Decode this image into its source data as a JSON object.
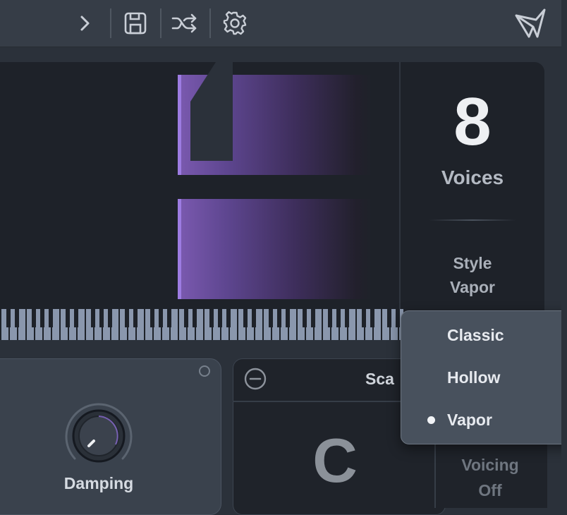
{
  "toolbar": {
    "icons": [
      "chevron-right-icon",
      "save-icon",
      "shuffle-icon",
      "gear-icon",
      "brand-logo"
    ]
  },
  "display": {
    "voices_count": "8",
    "voices_label": "Voices",
    "style_label": "Style",
    "style_value": "Vapor"
  },
  "damping": {
    "label": "Damping"
  },
  "scale": {
    "label": "Sca",
    "note": "C"
  },
  "voicing": {
    "label": "Voicing",
    "value": "Off"
  },
  "style_menu": {
    "options": [
      {
        "label": "Classic",
        "selected": false
      },
      {
        "label": "Hollow",
        "selected": false
      },
      {
        "label": "Vapor",
        "selected": true
      }
    ]
  },
  "colors": {
    "accent": "#9d7ce2",
    "background": "#2b313a",
    "panel": "#1e2229"
  }
}
